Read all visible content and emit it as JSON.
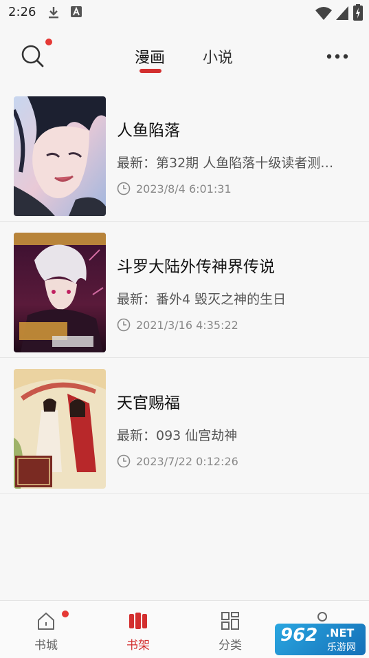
{
  "status_bar": {
    "time": "2:26",
    "icons": [
      "download-icon",
      "keyboard-a-icon",
      "wifi-icon",
      "signal-icon",
      "battery-charging-icon"
    ]
  },
  "header": {
    "tabs": [
      {
        "label": "漫画",
        "active": true
      },
      {
        "label": "小说",
        "active": false
      }
    ],
    "icons": [
      "search-icon",
      "more-icon"
    ],
    "accent_color": "#d32f2f",
    "badge_color": "#e53935"
  },
  "books": [
    {
      "title": "人鱼陷落",
      "latest": "最新：第32期 人鱼陷落十级读者测…",
      "time": "2023/8/4 6:01:31"
    },
    {
      "title": "斗罗大陆外传神界传说",
      "latest": "最新：番外4 毁灭之神的生日",
      "time": "2021/3/16 4:35:22"
    },
    {
      "title": "天官赐福",
      "latest": "最新：093 仙宫劫神",
      "time": "2023/7/22 0:12:26"
    }
  ],
  "bottom_nav": [
    {
      "label": "书城",
      "icon": "home-icon",
      "active": false,
      "badge": true
    },
    {
      "label": "书架",
      "icon": "bookshelf-icon",
      "active": true,
      "badge": false
    },
    {
      "label": "分类",
      "icon": "category-grid-icon",
      "active": false,
      "badge": false
    },
    {
      "label": "",
      "icon": "profile-icon",
      "active": false,
      "badge": false
    }
  ],
  "watermark": {
    "brand": "962",
    "suffix": ".NET",
    "sub": "乐游网"
  }
}
